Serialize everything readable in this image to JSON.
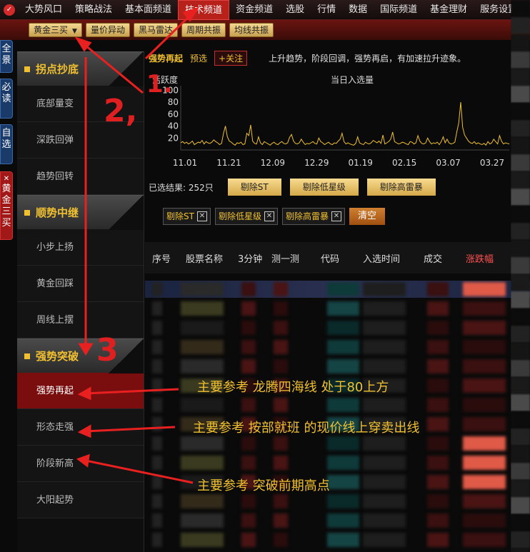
{
  "nav": {
    "items": [
      "大势风口",
      "策略战法",
      "基本面频道",
      "技术频道",
      "资金频道",
      "选股",
      "行情",
      "数据",
      "国际频道",
      "基金理财",
      "服务设置"
    ],
    "active_index": 3
  },
  "subbar": {
    "items": [
      "黄金三买",
      "量价异动",
      "黑马雷达",
      "周期共振",
      "均线共振"
    ],
    "dropdown_arrow": "▼"
  },
  "vtabs": {
    "items": [
      "全景",
      "必读",
      "自选"
    ],
    "active": "黄金三买",
    "close": "✕"
  },
  "leftmenu": {
    "categories": [
      {
        "title": "拐点抄底",
        "items": [
          "底部量变",
          "深跌回弹",
          "趋势回转"
        ]
      },
      {
        "title": "顺势中继",
        "items": [
          "小步上扬",
          "黄金回踩",
          "周线上摆"
        ]
      },
      {
        "title": "强势突破",
        "items": [
          "强势再起",
          "形态走强",
          "阶段新高",
          "大阳起势"
        ]
      }
    ],
    "selected": "强势再起"
  },
  "content": {
    "title": "强势再起",
    "preselect": "预选",
    "follow": "+关注",
    "description": "上升趋势，阶段回调，强势再启，有加速拉升迹象。",
    "result_label": "已选结果: 252只",
    "filter_buttons": [
      "剔除ST",
      "剔除低星级",
      "剔除高雷暴"
    ],
    "tags": [
      "剔除ST",
      "剔除低星级",
      "剔除高雷暴"
    ],
    "tag_close": "✕",
    "clear_label": "清空",
    "table_headers": [
      "序号",
      "股票名称",
      "3分钟",
      "测一测",
      "代码",
      "入选时间",
      "成交",
      "涨跌幅"
    ]
  },
  "chart_data": {
    "type": "line",
    "ylabel": "活跃度",
    "title": "当日入选量",
    "yticks": [
      20,
      40,
      60,
      80,
      100
    ],
    "ylim": [
      0,
      110
    ],
    "xticks": [
      "11.01",
      "11.21",
      "12.09",
      "12.29",
      "01.19",
      "02.15",
      "03.07",
      "03.27"
    ],
    "line_color": "#f0c030",
    "series": [
      {
        "values": [
          12,
          14,
          11,
          13,
          10,
          12,
          15,
          9,
          11,
          13,
          12,
          16,
          10,
          14,
          12,
          11,
          13,
          17,
          14,
          12,
          9,
          11,
          28,
          40,
          22,
          15,
          13,
          10,
          8,
          12,
          11,
          13,
          9,
          10,
          28,
          24,
          42,
          15,
          11,
          10,
          22,
          12,
          9,
          14,
          12,
          10,
          8,
          11,
          13,
          10,
          9,
          12,
          14,
          11,
          10,
          12,
          21,
          26,
          15,
          11,
          10,
          12,
          18,
          13,
          9,
          11,
          10,
          12,
          14,
          11,
          10,
          20,
          14,
          12,
          9,
          11,
          13,
          10,
          9,
          12,
          11,
          15,
          18,
          28,
          14,
          10,
          12,
          10,
          9,
          8,
          11,
          22,
          12,
          10,
          9,
          13,
          11,
          10,
          12,
          16,
          14,
          12,
          15,
          11,
          25,
          10,
          12,
          14,
          18,
          30,
          14,
          12,
          10,
          11,
          13,
          12,
          10,
          9,
          14,
          13,
          10,
          12,
          24,
          15,
          11,
          10,
          12,
          20,
          14,
          10,
          12,
          11,
          13,
          9,
          14,
          22,
          12,
          18,
          12,
          10,
          11,
          13,
          30,
          45,
          80,
          38,
          25,
          20,
          15,
          12,
          11,
          14,
          10,
          12,
          10,
          9,
          11,
          8,
          14,
          10,
          12,
          18,
          14,
          10,
          24,
          15,
          10,
          12,
          11,
          10
        ]
      }
    ]
  },
  "annotations": {
    "num1": "1.",
    "num2": "2,",
    "num3": "3",
    "note1": "主要参考 龙腾四海线 处于80上方",
    "note2": "主要参考 按部就班 的现价线上穿卖出线",
    "note3": "主要参考 突破前期高点"
  }
}
